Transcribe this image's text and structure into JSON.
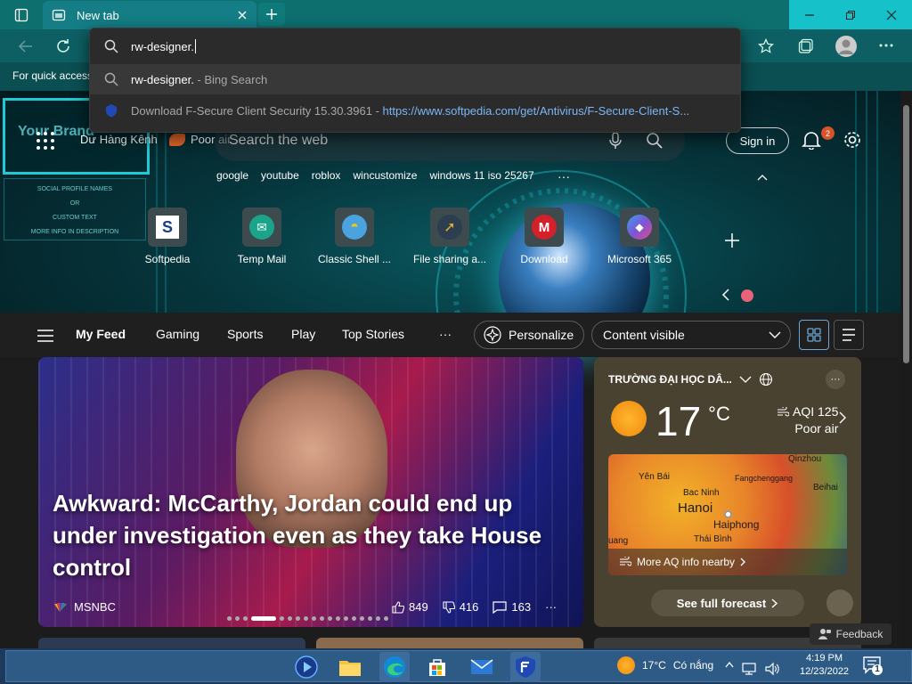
{
  "browser": {
    "tab_title": "New tab",
    "omnibox_text": "rw-designer.",
    "favorites_hint": "For quick access",
    "suggestions": [
      {
        "main": "rw-designer.",
        "suffix": " - Bing Search"
      },
      {
        "main": "Download F-Secure Client Security 15.30.3961",
        "suffix": " - ",
        "link": "https://www.softpedia.com/get/Antivirus/F-Secure-Client-S..."
      }
    ]
  },
  "newtab": {
    "brand_text": "Your Brand",
    "social_text": [
      "SOCIAL PROFILE NAMES",
      "OR",
      "CUSTOM TEXT",
      "MORE INFO IN DESCRIPTION"
    ],
    "pill_user": "Dư Hàng Kênh",
    "pill_air": "Poor air",
    "search_placeholder": "Search the web",
    "signin": "Sign in",
    "notif_count": "2",
    "quick_links": [
      "google",
      "youtube",
      "roblox",
      "wincustomize",
      "windows 11 iso 25267"
    ],
    "tiles": [
      {
        "label": "Softpedia",
        "glyph": "S",
        "color": "#1a3b8f"
      },
      {
        "label": "Temp Mail",
        "glyph": "✉",
        "color": "#1aa58a"
      },
      {
        "label": "Classic Shell ...",
        "glyph": "◓",
        "color": "#4aa3df"
      },
      {
        "label": "File sharing a...",
        "glyph": "➚",
        "color": "#e1b12c"
      },
      {
        "label": "Download",
        "glyph": "M",
        "color": "#d3202a"
      },
      {
        "label": "Microsoft 365",
        "glyph": "◆",
        "color": "#7b55d6"
      }
    ]
  },
  "feed": {
    "nav": [
      "My Feed",
      "Gaming",
      "Sports",
      "Play",
      "Top Stories"
    ],
    "more": "···",
    "personalize": "Personalize",
    "content_visible": "Content visible",
    "headline": "Awkward: McCarthy, Jordan could end up under investigation even as they take House control",
    "source": "MSNBC",
    "likes": "849",
    "dislikes": "416",
    "comments": "163"
  },
  "weather": {
    "location": "TRƯỜNG ĐẠI HỌC DÂ...",
    "temp": "17",
    "unit": "°C",
    "aqi": "AQI 125",
    "aqi_status": "Poor air",
    "map_cities": [
      "Yên Bái",
      "Qinzhou",
      "Fangchenggang",
      "Bac Ninh",
      "Beihai",
      "Hanoi",
      "Haiphong",
      "Thái Bình",
      "uang"
    ],
    "aq_link": "More AQ info nearby",
    "forecast_btn": "See full forecast"
  },
  "feedback": "Feedback",
  "taskbar": {
    "weather_temp": "17°C",
    "weather_text": "Có nắng",
    "time": "4:19 PM",
    "date": "12/23/2022",
    "notif_count": "1"
  },
  "colors": {
    "accent_teal": "#16c1c9",
    "taskbar": "#1b3a5c",
    "weather_card": "#4a4231"
  }
}
